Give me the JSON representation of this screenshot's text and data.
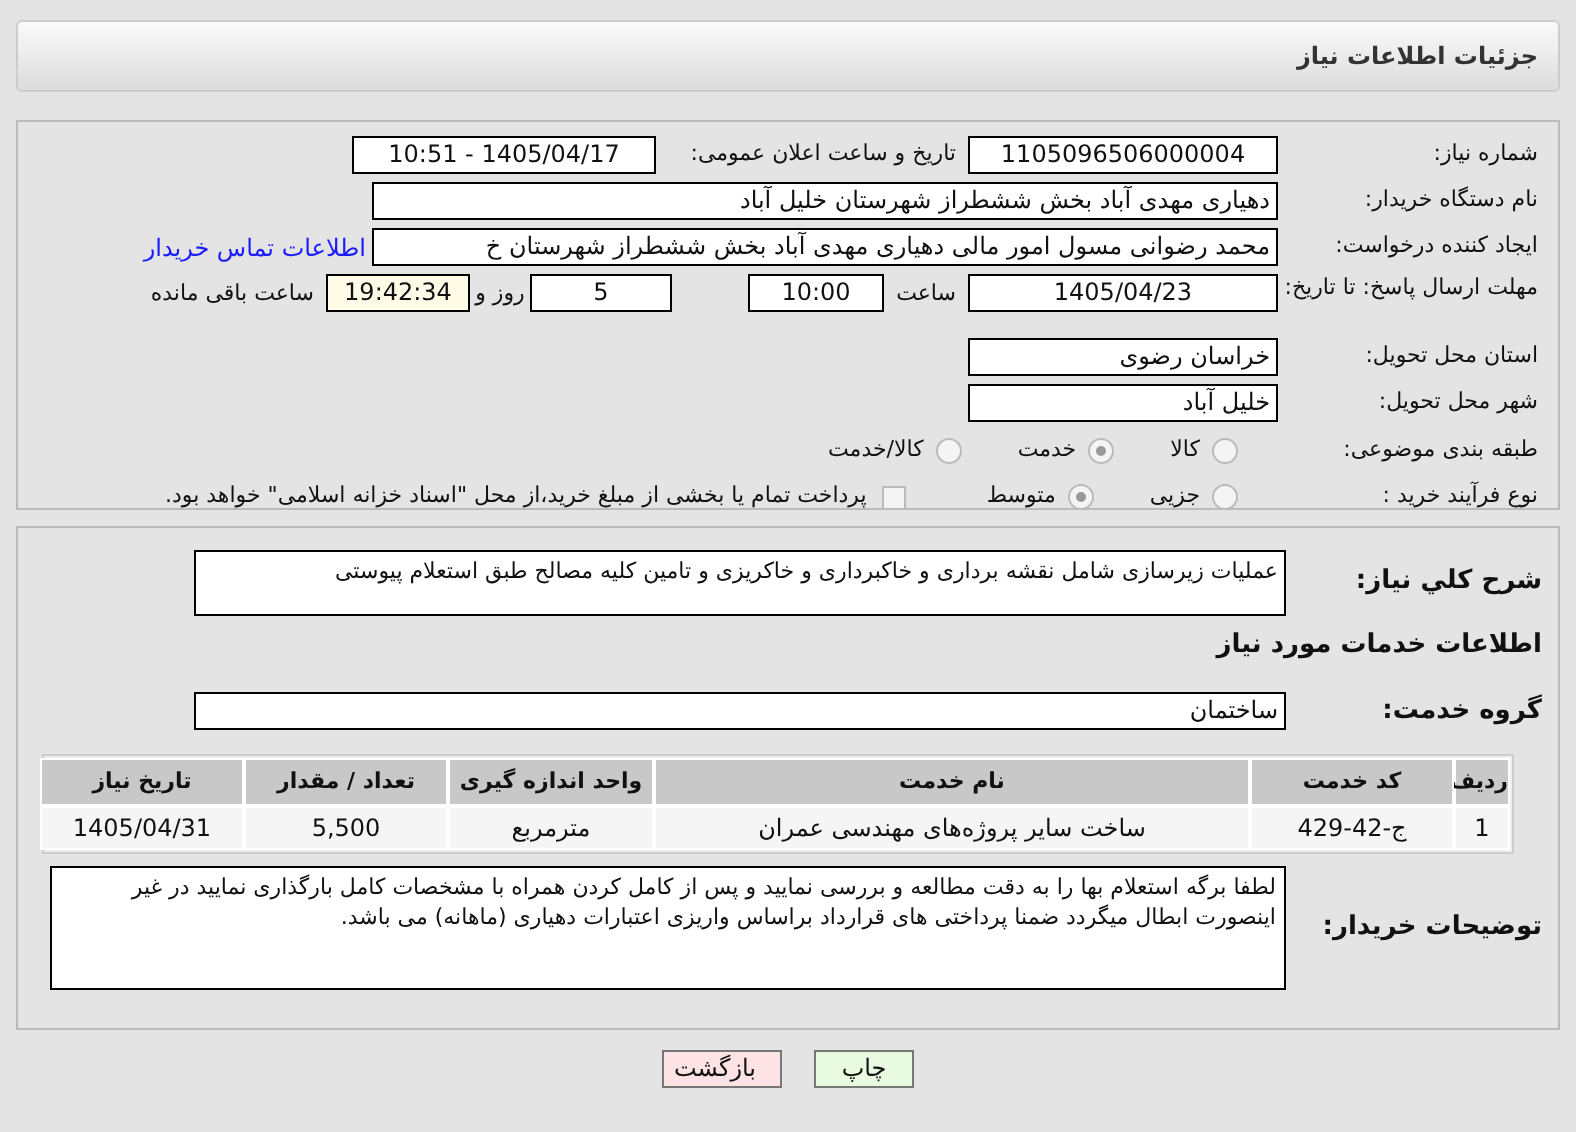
{
  "header": {
    "title": "جزئیات اطلاعات نیاز"
  },
  "details": {
    "need_number": {
      "label": "شماره نیاز:",
      "value": "1105096506000004"
    },
    "announce": {
      "label": "تاریخ و ساعت اعلان عمومی:",
      "value": "1405/04/17 - 10:51"
    },
    "buyer": {
      "label": "نام دستگاه خریدار:",
      "value": "دهیاری مهدی آباد بخش ششطراز شهرستان خلیل آباد"
    },
    "creator": {
      "label": "ایجاد کننده درخواست:",
      "value": "محمد رضوانی مسول امور مالی دهیاری مهدی آباد بخش ششطراز شهرستان خ",
      "link": "اطلاعات تماس خریدار"
    },
    "deadline": {
      "label": "مهلت ارسال پاسخ: تا تاریخ:",
      "date": "1405/04/23",
      "time_label": "ساعت",
      "time": "10:00",
      "days": "5",
      "days_label": "روز و",
      "remaining": "19:42:34",
      "remaining_label": "ساعت باقی مانده"
    },
    "province": {
      "label": "استان محل تحویل:",
      "value": "خراسان رضوی"
    },
    "city": {
      "label": "شهر محل تحویل:",
      "value": "خلیل آباد"
    },
    "category": {
      "label": "طبقه بندی موضوعی:",
      "options": [
        {
          "label": "کالا",
          "selected": false
        },
        {
          "label": "خدمت",
          "selected": true
        },
        {
          "label": "کالا/خدمت",
          "selected": false
        }
      ]
    },
    "process": {
      "label": "نوع فرآیند خرید :",
      "options": [
        {
          "label": "جزیی",
          "selected": false
        },
        {
          "label": "متوسط",
          "selected": true
        }
      ],
      "payment": {
        "label": "پرداخت تمام یا بخشی از مبلغ خرید،از محل \"اسناد خزانه اسلامی\" خواهد بود.",
        "checked": false
      }
    }
  },
  "need": {
    "description_label": "شرح کلي نياز:",
    "description": "عملیات زیرسازی شامل نقشه برداری و خاکبرداری و خاکریزی و تامین کلیه مصالح طبق استعلام پیوستی",
    "services_title": "اطلاعات خدمات مورد نیاز",
    "group_label": "گروه خدمت:",
    "group": "ساختمان",
    "table": {
      "columns": [
        "ردیف",
        "کد خدمت",
        "نام خدمت",
        "واحد اندازه گیری",
        "تعداد / مقدار",
        "تاریخ نیاز"
      ],
      "rows": [
        [
          "1",
          "ج-42-429",
          "ساخت سایر پروژه‌های مهندسی عمران",
          "مترمربع",
          "5,500",
          "1405/04/31"
        ]
      ]
    },
    "notes_label": "توضیحات خریدار:",
    "notes": "لطفا برگه استعلام بها را به دقت مطالعه و بررسی نمایید و پس از کامل کردن همراه با مشخصات کامل بارگذاری نمایید در غیر اینصورت ابطال میگردد ضمنا پرداختی های قرارداد براساس واریزی اعتبارات دهیاری (ماهانه) می باشد."
  },
  "buttons": [
    {
      "label": "چاپ",
      "kind": "print"
    },
    {
      "label": "بازگشت",
      "kind": "back"
    }
  ]
}
